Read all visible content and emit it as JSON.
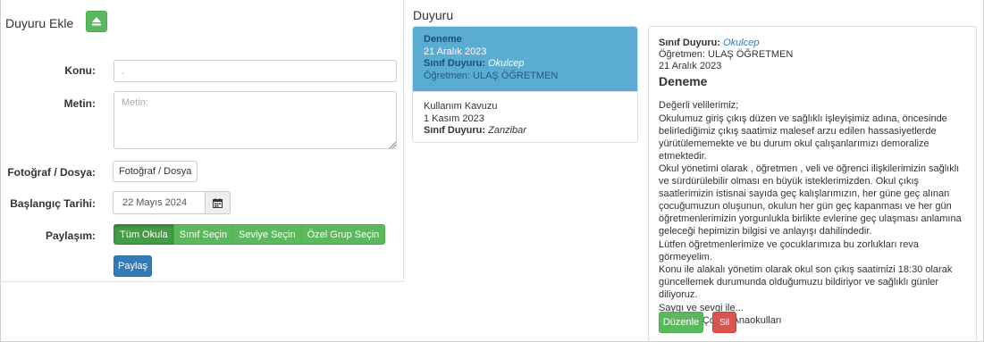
{
  "form": {
    "title": "Duyuru Ekle",
    "subject_label": "Konu:",
    "subject_value": ".",
    "text_label": "Metin:",
    "text_placeholder": "Metin:",
    "file_label": "Fotoğraf / Dosya:",
    "file_button": "Fotoğraf / Dosya",
    "start_date_label": "Başlangıç Tarihi:",
    "start_date_value": "22 Mayıs 2024",
    "share_label": "Paylaşım:",
    "share_options": [
      "Tüm Okula",
      "Sınıf Seçin",
      "Seviye Seçin",
      "Özel Grup Seçin"
    ],
    "share_selected": "Tüm Okula",
    "share_button": "Paylaş"
  },
  "list": {
    "title": "Duyuru",
    "items": [
      {
        "title": "Deneme",
        "date": "21 Aralık 2023",
        "scope_label": "Sınıf Duyuru:",
        "scope_value": "Okulcep",
        "teacher": "Öğretmen: ULAŞ ÖĞRETMEN",
        "active": true
      },
      {
        "title": "Kullanım Kavuzu",
        "date": "1 Kasım 2023",
        "scope_label": "Sınıf Duyuru:",
        "scope_value": "Zanzibar",
        "active": false
      }
    ]
  },
  "detail": {
    "scope_label": "Sınıf Duyuru:",
    "scope_value": "Okulcep",
    "teacher": "Öğretmen: ULAŞ ÖĞRETMEN",
    "date": "21 Aralık 2023",
    "title": "Deneme",
    "body": [
      "Değerli velilerimiz;",
      "Okulumuz giriş çıkış düzen ve sağlıklı işleyişimiz adına, öncesinde belirlediğimiz çıkış saatimiz malesef arzu edilen hassasiyetlerde yürütülememekte ve bu durum okul çalışanlarımızı demoralize etmektedir.",
      "Okul yönetimi olarak , öğretmen , veli ve öğrenci ilişkilerimizin sağlıklı ve sürdürülebilir olması en büyük isteklerimizden. Okul çıkış saatlerimizin istisnai sayıda geç kalışlarımızın, her güne geç alınan çocuğumuzun oluşunun, okulun her gün geç kapanması ve her gün öğretmenlerimizin yorgunlukla birlikte evlerine geç ulaşması anlamına geleceği hepimizin bilgisi ve anlayışı dahilindedir.",
      "Lütfen öğretmenlerimize ve çocuklarımıza bu zorlukları reva görmeyelim.",
      "Konu ile alakalı yönetim olarak okul son çıkış saatimizi 18:30 olarak güncellemek durumunda olduğumuzu bildiriyor ve sağlıklı günler diliyoruz.",
      "Saygı ve sevgi ile...",
      "Özel Mini Çocuk Anaokulları"
    ],
    "edit_button": "Düzenle",
    "delete_button": "Sil"
  },
  "colors": {
    "success": "#5cb85c",
    "primary": "#337ab7",
    "danger": "#d9534f",
    "active_item": "#5bacd1"
  },
  "icons": {
    "collapse": "eject-icon",
    "calendar": "calendar-icon"
  }
}
